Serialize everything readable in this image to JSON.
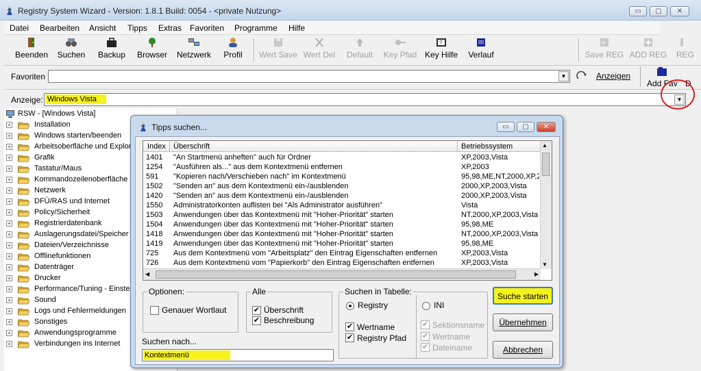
{
  "window": {
    "title": "Registry System Wizard - Version: 1.8.1 Build: 0054 - <private Nutzung>",
    "controls": {
      "minimize": "▭",
      "maximize": "▢",
      "close": "✕"
    }
  },
  "menu": [
    "Datei",
    "Bearbeiten",
    "Ansicht",
    "Tipps",
    "Extras",
    "Favoriten",
    "Programme",
    "Hilfe"
  ],
  "toolbar": {
    "beenden": "Beenden",
    "suchen": "Suchen",
    "backup": "Backup",
    "browser": "Browser",
    "netzwerk": "Netzwerk",
    "profil": "Profil",
    "wert_save": "Wert Save",
    "wert_del": "Wert Del",
    "default": "Default",
    "key_pfad": "Key Pfad",
    "key_hilfe": "Key Hilfe",
    "verlauf": "Verlauf",
    "save_reg": "Save REG",
    "add_reg": "ADD REG",
    "reg": "REG"
  },
  "favorites": {
    "label": "Favoriten",
    "value": "",
    "anzeigen": "Anzeigen",
    "add_fav": "Add Fav",
    "extra": "D"
  },
  "anzeige": {
    "label": "Anzeige:",
    "value": "Windows Vista"
  },
  "tree": {
    "root": "RSW - [Windows Vista]",
    "items": [
      "Installation",
      "Windows starten/beenden",
      "Arbeitsoberfläche und Explore",
      "Grafik",
      "Tastatur/Maus",
      "Kommandozeilenoberfläche (D",
      "Netzwerk",
      "DFÜ/RAS und Internet",
      "Policy/Sicherheit",
      "Registrierdatenbank",
      "Auslagerungsdatei/Speicher",
      "Dateien/Verzeichnisse",
      "Offlinefunktionen",
      "Datenträger",
      "Drucker",
      "Performance/Tuning - Einstel",
      "Sound",
      "Logs und Fehlermeldungen",
      "Sonstiges",
      "Anwendungsprogramme",
      "Verbindungen ins Internet"
    ]
  },
  "dialog": {
    "title": "Tipps suchen...",
    "columns": {
      "index": "Index",
      "ueberschrift": "Überschrift",
      "system": "Betriebssystem"
    },
    "rows": [
      {
        "index": "1401",
        "title": "\"An Startmenü anheften\" auch für Ordner",
        "os": "XP,2003,Vista"
      },
      {
        "index": "1254",
        "title": "\"Ausführen als...\" aus dem Kontextmenü entfernen",
        "os": "XP,2003"
      },
      {
        "index": "591",
        "title": "\"Kopieren nach/Verschieben nach\" im Kontextmenü",
        "os": "95,98,ME,NT,2000,XP,2"
      },
      {
        "index": "1502",
        "title": "\"Senden an\" aus dem Kontextmenü ein-/ausblenden",
        "os": "2000,XP,2003,Vista"
      },
      {
        "index": "1420",
        "title": "\"Senden an\" aus dem Kontextmenü ein-/ausblenden",
        "os": "2000,XP,2003,Vista"
      },
      {
        "index": "1550",
        "title": "Administratorkonten auflisten bei \"Als Administrator ausführen\"",
        "os": "Vista"
      },
      {
        "index": "1503",
        "title": "Anwendungen über das Kontextmenü mit \"Hoher-Priorität\" starten",
        "os": "NT,2000,XP,2003,Vista"
      },
      {
        "index": "1504",
        "title": "Anwendungen über das Kontextmenü mit \"Hoher-Priorität\" starten",
        "os": "95,98,ME"
      },
      {
        "index": "1418",
        "title": "Anwendungen über das Kontextmenü mit \"Hoher-Priorität\" starten",
        "os": "NT,2000,XP,2003,Vista"
      },
      {
        "index": "1419",
        "title": "Anwendungen über das Kontextmenü mit \"Hoher-Priorität\" starten",
        "os": "95,98,ME"
      },
      {
        "index": "725",
        "title": "Aus dem Kontextmenü vom \"Arbeitsplatz\" den Eintrag Eigenschaften entfernen",
        "os": "XP,2003,Vista"
      },
      {
        "index": "726",
        "title": "Aus dem Kontextmenü vom \"Papierkorb\" den Eintrag Eigenschaften entfernen",
        "os": "XP,2003,Vista"
      }
    ],
    "optionen": {
      "title": "Optionen:",
      "genauer_wortlaut": "Genauer Wortlaut",
      "checked": false
    },
    "alle": {
      "title": "Alle",
      "ueberschrift": "Überschrift",
      "beschreibung": "Beschreibung",
      "ueberschrift_checked": true,
      "beschreibung_checked": true
    },
    "suchen_in": {
      "title": "Suchen in Tabelle:",
      "registry": "Registry",
      "ini": "INI",
      "selected": "Registry",
      "wertname": "Wertname",
      "registry_pfad": "Registry Pfad",
      "sektionsname": "Sektionsname",
      "ini_wertname": "Wertname",
      "dateiname": "Dateiname"
    },
    "suchen_nach": {
      "label": "Suchen nach...",
      "value": "Kontextmenü"
    },
    "buttons": {
      "suche_starten": "Suche starten",
      "uebernehmen": "Übernehmen",
      "abbrechen": "Abbrechen"
    }
  }
}
